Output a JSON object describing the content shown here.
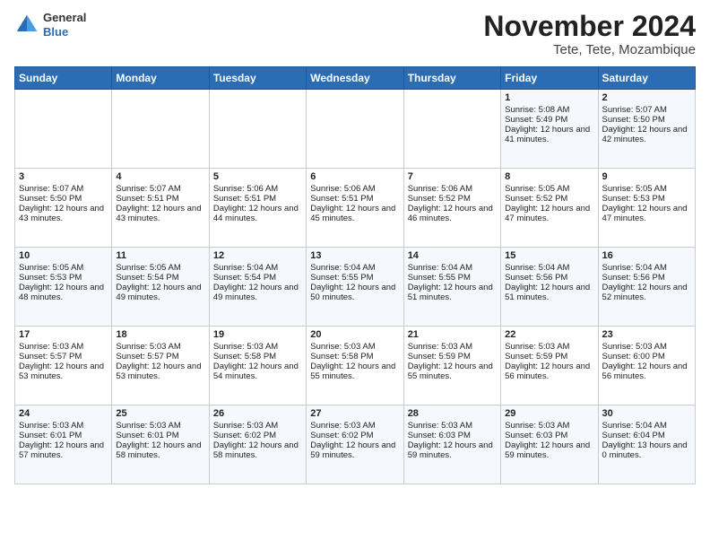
{
  "header": {
    "logo_line1": "General",
    "logo_line2": "Blue",
    "month": "November 2024",
    "location": "Tete, Tete, Mozambique"
  },
  "days_of_week": [
    "Sunday",
    "Monday",
    "Tuesday",
    "Wednesday",
    "Thursday",
    "Friday",
    "Saturday"
  ],
  "weeks": [
    [
      {
        "day": "",
        "sunrise": "",
        "sunset": "",
        "daylight": ""
      },
      {
        "day": "",
        "sunrise": "",
        "sunset": "",
        "daylight": ""
      },
      {
        "day": "",
        "sunrise": "",
        "sunset": "",
        "daylight": ""
      },
      {
        "day": "",
        "sunrise": "",
        "sunset": "",
        "daylight": ""
      },
      {
        "day": "",
        "sunrise": "",
        "sunset": "",
        "daylight": ""
      },
      {
        "day": "1",
        "sunrise": "Sunrise: 5:08 AM",
        "sunset": "Sunset: 5:49 PM",
        "daylight": "Daylight: 12 hours and 41 minutes."
      },
      {
        "day": "2",
        "sunrise": "Sunrise: 5:07 AM",
        "sunset": "Sunset: 5:50 PM",
        "daylight": "Daylight: 12 hours and 42 minutes."
      }
    ],
    [
      {
        "day": "3",
        "sunrise": "Sunrise: 5:07 AM",
        "sunset": "Sunset: 5:50 PM",
        "daylight": "Daylight: 12 hours and 43 minutes."
      },
      {
        "day": "4",
        "sunrise": "Sunrise: 5:07 AM",
        "sunset": "Sunset: 5:51 PM",
        "daylight": "Daylight: 12 hours and 43 minutes."
      },
      {
        "day": "5",
        "sunrise": "Sunrise: 5:06 AM",
        "sunset": "Sunset: 5:51 PM",
        "daylight": "Daylight: 12 hours and 44 minutes."
      },
      {
        "day": "6",
        "sunrise": "Sunrise: 5:06 AM",
        "sunset": "Sunset: 5:51 PM",
        "daylight": "Daylight: 12 hours and 45 minutes."
      },
      {
        "day": "7",
        "sunrise": "Sunrise: 5:06 AM",
        "sunset": "Sunset: 5:52 PM",
        "daylight": "Daylight: 12 hours and 46 minutes."
      },
      {
        "day": "8",
        "sunrise": "Sunrise: 5:05 AM",
        "sunset": "Sunset: 5:52 PM",
        "daylight": "Daylight: 12 hours and 47 minutes."
      },
      {
        "day": "9",
        "sunrise": "Sunrise: 5:05 AM",
        "sunset": "Sunset: 5:53 PM",
        "daylight": "Daylight: 12 hours and 47 minutes."
      }
    ],
    [
      {
        "day": "10",
        "sunrise": "Sunrise: 5:05 AM",
        "sunset": "Sunset: 5:53 PM",
        "daylight": "Daylight: 12 hours and 48 minutes."
      },
      {
        "day": "11",
        "sunrise": "Sunrise: 5:05 AM",
        "sunset": "Sunset: 5:54 PM",
        "daylight": "Daylight: 12 hours and 49 minutes."
      },
      {
        "day": "12",
        "sunrise": "Sunrise: 5:04 AM",
        "sunset": "Sunset: 5:54 PM",
        "daylight": "Daylight: 12 hours and 49 minutes."
      },
      {
        "day": "13",
        "sunrise": "Sunrise: 5:04 AM",
        "sunset": "Sunset: 5:55 PM",
        "daylight": "Daylight: 12 hours and 50 minutes."
      },
      {
        "day": "14",
        "sunrise": "Sunrise: 5:04 AM",
        "sunset": "Sunset: 5:55 PM",
        "daylight": "Daylight: 12 hours and 51 minutes."
      },
      {
        "day": "15",
        "sunrise": "Sunrise: 5:04 AM",
        "sunset": "Sunset: 5:56 PM",
        "daylight": "Daylight: 12 hours and 51 minutes."
      },
      {
        "day": "16",
        "sunrise": "Sunrise: 5:04 AM",
        "sunset": "Sunset: 5:56 PM",
        "daylight": "Daylight: 12 hours and 52 minutes."
      }
    ],
    [
      {
        "day": "17",
        "sunrise": "Sunrise: 5:03 AM",
        "sunset": "Sunset: 5:57 PM",
        "daylight": "Daylight: 12 hours and 53 minutes."
      },
      {
        "day": "18",
        "sunrise": "Sunrise: 5:03 AM",
        "sunset": "Sunset: 5:57 PM",
        "daylight": "Daylight: 12 hours and 53 minutes."
      },
      {
        "day": "19",
        "sunrise": "Sunrise: 5:03 AM",
        "sunset": "Sunset: 5:58 PM",
        "daylight": "Daylight: 12 hours and 54 minutes."
      },
      {
        "day": "20",
        "sunrise": "Sunrise: 5:03 AM",
        "sunset": "Sunset: 5:58 PM",
        "daylight": "Daylight: 12 hours and 55 minutes."
      },
      {
        "day": "21",
        "sunrise": "Sunrise: 5:03 AM",
        "sunset": "Sunset: 5:59 PM",
        "daylight": "Daylight: 12 hours and 55 minutes."
      },
      {
        "day": "22",
        "sunrise": "Sunrise: 5:03 AM",
        "sunset": "Sunset: 5:59 PM",
        "daylight": "Daylight: 12 hours and 56 minutes."
      },
      {
        "day": "23",
        "sunrise": "Sunrise: 5:03 AM",
        "sunset": "Sunset: 6:00 PM",
        "daylight": "Daylight: 12 hours and 56 minutes."
      }
    ],
    [
      {
        "day": "24",
        "sunrise": "Sunrise: 5:03 AM",
        "sunset": "Sunset: 6:01 PM",
        "daylight": "Daylight: 12 hours and 57 minutes."
      },
      {
        "day": "25",
        "sunrise": "Sunrise: 5:03 AM",
        "sunset": "Sunset: 6:01 PM",
        "daylight": "Daylight: 12 hours and 58 minutes."
      },
      {
        "day": "26",
        "sunrise": "Sunrise: 5:03 AM",
        "sunset": "Sunset: 6:02 PM",
        "daylight": "Daylight: 12 hours and 58 minutes."
      },
      {
        "day": "27",
        "sunrise": "Sunrise: 5:03 AM",
        "sunset": "Sunset: 6:02 PM",
        "daylight": "Daylight: 12 hours and 59 minutes."
      },
      {
        "day": "28",
        "sunrise": "Sunrise: 5:03 AM",
        "sunset": "Sunset: 6:03 PM",
        "daylight": "Daylight: 12 hours and 59 minutes."
      },
      {
        "day": "29",
        "sunrise": "Sunrise: 5:03 AM",
        "sunset": "Sunset: 6:03 PM",
        "daylight": "Daylight: 12 hours and 59 minutes."
      },
      {
        "day": "30",
        "sunrise": "Sunrise: 5:04 AM",
        "sunset": "Sunset: 6:04 PM",
        "daylight": "Daylight: 13 hours and 0 minutes."
      }
    ]
  ]
}
